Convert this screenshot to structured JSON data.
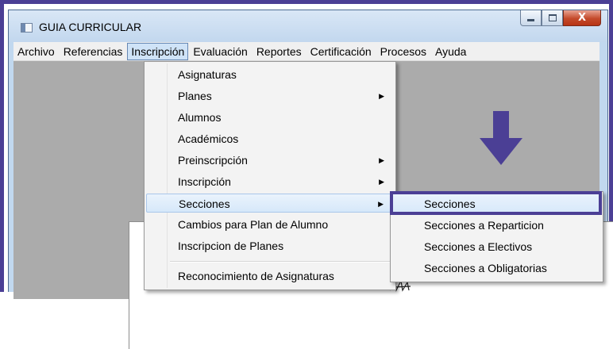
{
  "window": {
    "title": "GUIA CURRICULAR",
    "controls": {
      "minimize_icon": "minimize-icon",
      "maximize_icon": "maximize-icon",
      "close_glyph": "X"
    }
  },
  "menubar": {
    "items": [
      "Archivo",
      "Referencias",
      "Inscripción",
      "Evaluación",
      "Reportes",
      "Certificación",
      "Procesos",
      "Ayuda"
    ],
    "active": "Inscripción"
  },
  "dropdown": {
    "items": [
      {
        "label": "Asignaturas",
        "submenu": false
      },
      {
        "label": "Planes",
        "submenu": true
      },
      {
        "label": "Alumnos",
        "submenu": false
      },
      {
        "label": "Académicos",
        "submenu": false
      },
      {
        "label": "Preinscripción",
        "submenu": true
      },
      {
        "label": "Inscripción",
        "submenu": true
      },
      {
        "label": "Secciones",
        "submenu": true,
        "highlighted": true
      },
      {
        "label": "Cambios para Plan de Alumno",
        "submenu": false
      },
      {
        "label": "Inscripcion de Planes",
        "submenu": false
      },
      {
        "label": "Reconocimiento de Asignaturas",
        "submenu": false
      }
    ],
    "arrow_glyph": "▶"
  },
  "submenu": {
    "items": [
      "Secciones",
      "Secciones a Reparticion",
      "Secciones a Electivos",
      "Secciones a Obligatorias"
    ],
    "selected": "Secciones"
  },
  "colors": {
    "annotation": "#4b3f95",
    "window_frame": "#c1d8ef",
    "client_area": "#ababab",
    "menu_highlight": "#d6e8fa"
  }
}
